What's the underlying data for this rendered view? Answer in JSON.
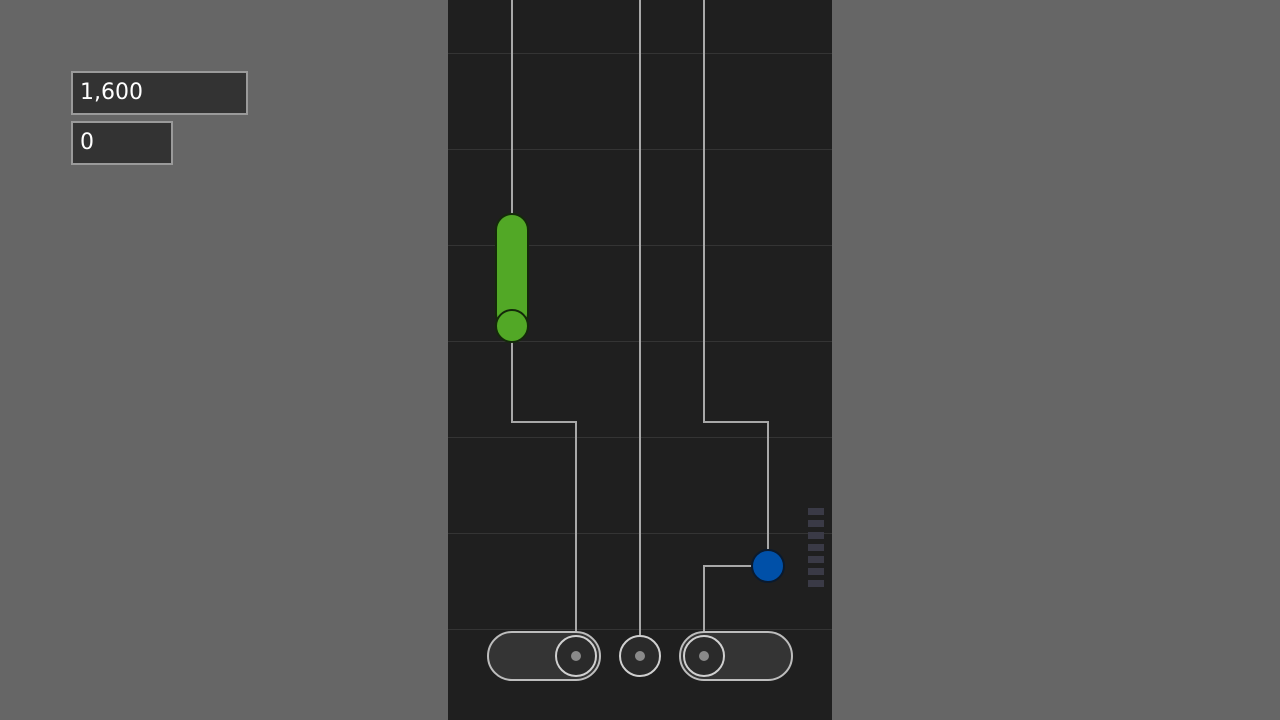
{
  "hud": {
    "score": "1,600",
    "combo": "0"
  },
  "colors": {
    "background": "#666666",
    "playfield": "#1f1f1f",
    "gridline": "#343434",
    "track": "#a8a8a8",
    "hold_note": "#52a826",
    "tap_note": "#0050a8",
    "receptor_ring": "#c8c8c8",
    "meter_segment": "#3a3a46"
  },
  "lanes": [
    {
      "id": "left",
      "receptor": "slider-left"
    },
    {
      "id": "center",
      "receptor": "center-button"
    },
    {
      "id": "right",
      "receptor": "slider-right"
    }
  ],
  "notes": [
    {
      "type": "hold",
      "lane": "left",
      "color": "green"
    },
    {
      "type": "tap",
      "lane": "right",
      "color": "blue"
    }
  ],
  "meter": {
    "segments": 7
  }
}
